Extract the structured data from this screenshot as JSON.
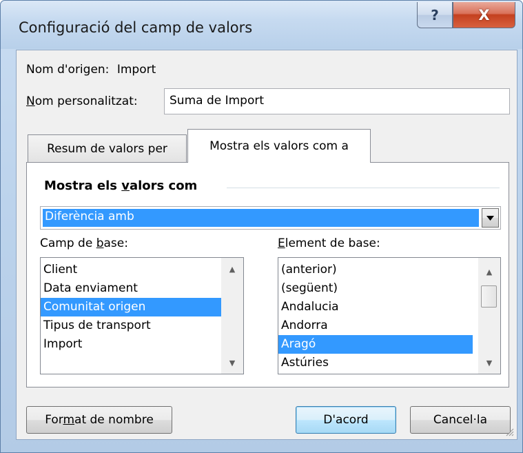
{
  "window": {
    "title": "Configuració del camp de valors",
    "help_label": "?",
    "close_label": "X"
  },
  "source": {
    "label": "Nom d'origen:",
    "value": "Import"
  },
  "custom_name": {
    "label_mnemonic": "N",
    "label_rest": "om personalitzat:",
    "value": "Suma de Import"
  },
  "tabs": [
    {
      "label": "Resum de valors per",
      "active": false
    },
    {
      "label": "Mostra els valors com a",
      "active": true
    }
  ],
  "show_values": {
    "heading_before": "Mostra els ",
    "heading_mnemonic": "v",
    "heading_after": "alors com",
    "selected": "Diferència amb"
  },
  "base_field": {
    "label_before": "Camp de ",
    "label_mnemonic": "b",
    "label_after": "ase:",
    "items": [
      "Client",
      "Data enviament",
      "Comunitat origen",
      "Tipus de transport",
      "Import"
    ],
    "selected_index": 2
  },
  "base_item": {
    "label_mnemonic": "E",
    "label_rest": "lement de base:",
    "items": [
      "(anterior)",
      "(següent)",
      "Andalucia",
      "Andorra",
      "Aragó",
      "Astúries"
    ],
    "selected_index": 4
  },
  "buttons": {
    "number_format_before": "For",
    "number_format_mnemonic": "m",
    "number_format_after": "at de nombre",
    "ok": "D'acord",
    "cancel": "Cancel·la"
  },
  "colors": {
    "selection": "#3399ff",
    "close_button": "#c4401f",
    "title_bar": "#c6daf0"
  }
}
